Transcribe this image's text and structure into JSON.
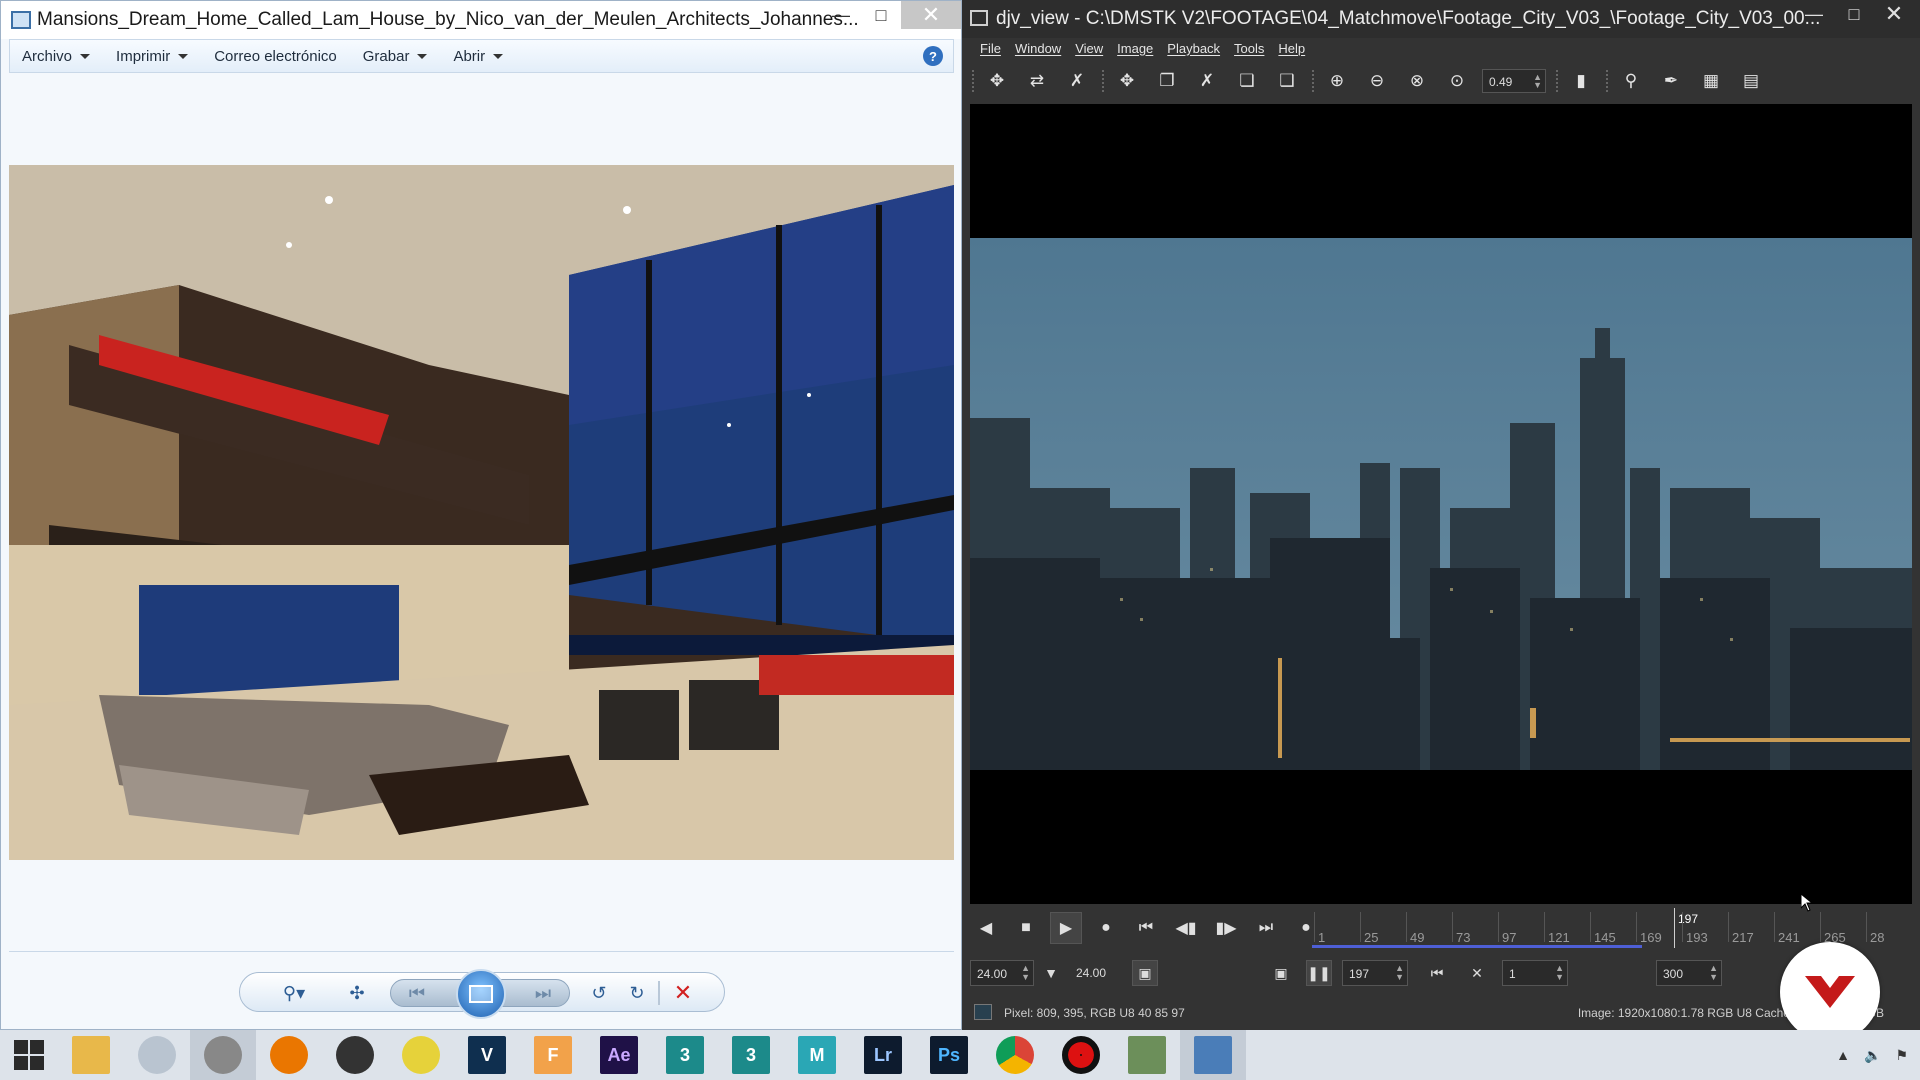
{
  "photo_viewer": {
    "title": "Mansions_Dream_Home_Called_Lam_House_by_Nico_van_der_Meulen_Architects_Johannes...",
    "menu": [
      "Archivo",
      "Imprimir",
      "Correo electrónico",
      "Grabar",
      "Abrir"
    ],
    "menu_has_caret": [
      true,
      true,
      false,
      true,
      true
    ],
    "help_icon": "help-icon"
  },
  "djv": {
    "title": "djv_view - C:\\DMSTK V2\\FOOTAGE\\04_Matchmove\\Footage_City_V03_\\Footage_City_V03_00...",
    "menu": [
      "File",
      "Window",
      "View",
      "Image",
      "Playback",
      "Tools",
      "Help"
    ],
    "zoom_value": "0.49",
    "timeline": {
      "ticks": [
        "1",
        "25",
        "49",
        "73",
        "97",
        "121",
        "145",
        "169",
        "193",
        "217",
        "241",
        "265",
        "28"
      ],
      "current_frame": "197"
    },
    "controls": {
      "fps": "24.00",
      "fps_actual": "24.00",
      "frame": "197",
      "frame_step": "1",
      "end_frame": "300"
    },
    "status": {
      "pixel": "Pixel: 809, 395, RGB U8 40 85 97",
      "image_info": "Image: 1920x1080:1.78 RGB U8  Cache:",
      "suffix": "GB"
    }
  },
  "taskbar": {
    "apps": [
      "file-explorer-icon",
      "paint-icon",
      "media-player-icon",
      "blender-icon",
      "davinci-resolve-icon",
      "sketch-icon",
      "v-ray-icon",
      "fusion-icon",
      "after-effects-icon",
      "3ds-max-icon",
      "3ds-max-icon",
      "maya-icon",
      "lightroom-icon",
      "photoshop-icon",
      "chrome-icon",
      "recorder-icon",
      "spreadsheet-icon",
      "photo-viewer-icon"
    ],
    "labels": {
      "ae": "Ae",
      "lr": "Lr",
      "ps": "Ps",
      "v": "V",
      "f": "F",
      "three": "3",
      "maya": "M"
    }
  }
}
